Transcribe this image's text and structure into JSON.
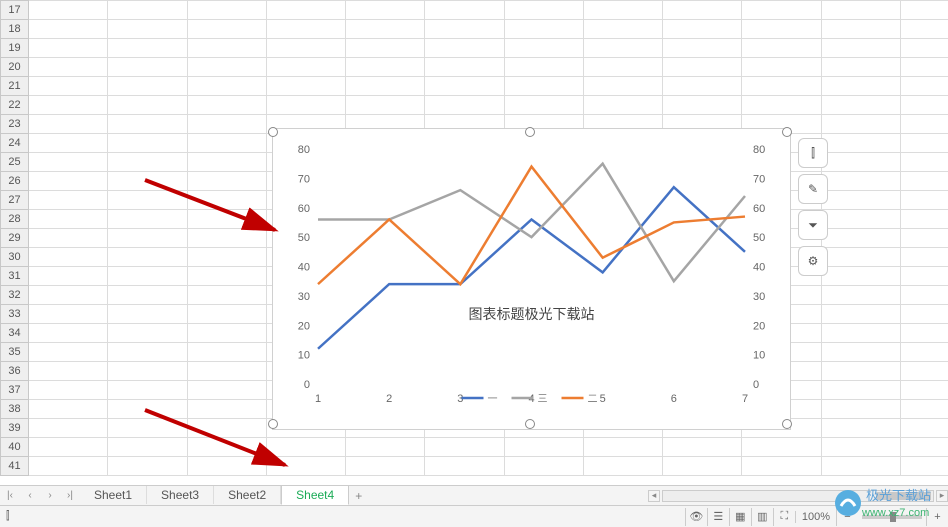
{
  "rows_start": 17,
  "rows_end": 41,
  "chart_data": {
    "type": "line",
    "categories": [
      1,
      2,
      3,
      4,
      5,
      6,
      7
    ],
    "series": [
      {
        "name": "一",
        "color": "#4472c4",
        "values": [
          12,
          34,
          34,
          56,
          38,
          67,
          45
        ]
      },
      {
        "name": "三",
        "color": "#a5a5a5",
        "values": [
          56,
          56,
          66,
          50,
          75,
          35,
          64
        ]
      },
      {
        "name": "二",
        "color": "#ed7d31",
        "values": [
          34,
          56,
          34,
          74,
          43,
          55,
          57
        ]
      }
    ],
    "title": "图表标题极光下载站",
    "xlabel": "",
    "ylabel": "",
    "ylim": [
      0,
      80
    ],
    "ystep": 10,
    "legend_position": "bottom",
    "secondary_axis": true
  },
  "side_tools": [
    {
      "name": "chart-elements-icon",
      "glyph": "⫿"
    },
    {
      "name": "chart-styles-icon",
      "glyph": "✎"
    },
    {
      "name": "chart-filter-icon",
      "glyph": "⏷"
    },
    {
      "name": "chart-settings-icon",
      "glyph": "⚙"
    }
  ],
  "sheets": {
    "items": [
      {
        "label": "Sheet1",
        "active": false
      },
      {
        "label": "Sheet3",
        "active": false
      },
      {
        "label": "Sheet2",
        "active": false
      },
      {
        "label": "Sheet4",
        "active": true
      }
    ],
    "add_glyph": "+"
  },
  "status": {
    "ready_glyph": "⫿",
    "zoom": "100%"
  },
  "watermark": {
    "top": "极光下载站",
    "bottom": "www.xz7.com"
  }
}
